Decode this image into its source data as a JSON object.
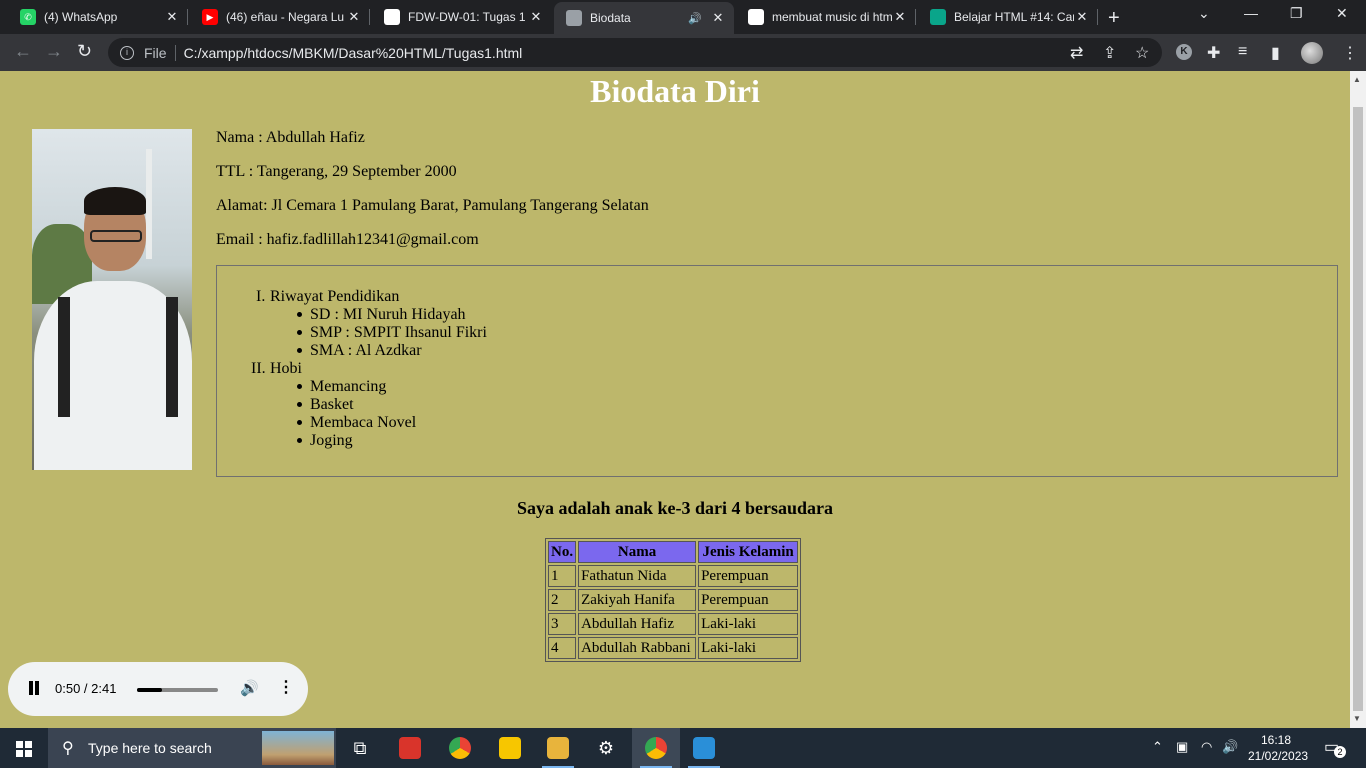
{
  "browser": {
    "tabs": [
      {
        "title": "(4) WhatsApp",
        "icon": "whatsapp-icon"
      },
      {
        "title": "(46) eñau - Negara Lu",
        "icon": "youtube-icon"
      },
      {
        "title": "FDW-DW-01: Tugas 1",
        "icon": "document-icon"
      },
      {
        "title": "Biodata",
        "icon": "globe-icon",
        "active": true,
        "audio": true
      },
      {
        "title": "membuat music di htm",
        "icon": "google-icon"
      },
      {
        "title": "Belajar HTML #14: Car",
        "icon": "site-icon"
      }
    ],
    "file_label": "File",
    "url": "C:/xampp/htdocs/MBKM/Dasar%20HTML/Tugas1.html",
    "profile_initial": "K"
  },
  "page": {
    "heading": "Biodata Diri",
    "nama": "Nama : Abdullah Hafiz",
    "ttl": "TTL : Tangerang, 29 September 2000",
    "alamat": "Alamat: Jl Cemara 1 Pamulang Barat, Pamulang Tangerang Selatan",
    "email": "Email : hafiz.fadlillah12341@gmail.com",
    "list": [
      {
        "marker": "I.",
        "label": "Riwayat Pendidikan",
        "items": [
          "SD : MI Nuruh Hidayah",
          "SMP : SMPIT Ihsanul Fikri",
          "SMA : Al Azdkar"
        ]
      },
      {
        "marker": "II.",
        "label": "Hobi",
        "items": [
          "Memancing",
          "Basket",
          "Membaca Novel",
          "Joging"
        ]
      }
    ],
    "sibling_text": "Saya adalah anak ke-3 dari 4 bersaudara",
    "table": {
      "headers": [
        "No.",
        "Nama",
        "Jenis Kelamin"
      ],
      "rows": [
        [
          "1",
          "Fathatun Nida",
          "Perempuan"
        ],
        [
          "2",
          "Zakiyah Hanifa",
          "Perempuan"
        ],
        [
          "3",
          "Abdullah Hafiz",
          "Laki-laki"
        ],
        [
          "4",
          "Abdullah Rabbani",
          "Laki-laki"
        ]
      ]
    },
    "colors": {
      "background": "#bdb76b",
      "header_cell": "#7b68ee",
      "heading_text": "#ffffff"
    }
  },
  "audio": {
    "time": "0:50 / 2:41",
    "progress": 0.31
  },
  "taskbar": {
    "search_placeholder": "Type here to search",
    "time": "16:18",
    "date": "21/02/2023",
    "notifications": "2"
  }
}
